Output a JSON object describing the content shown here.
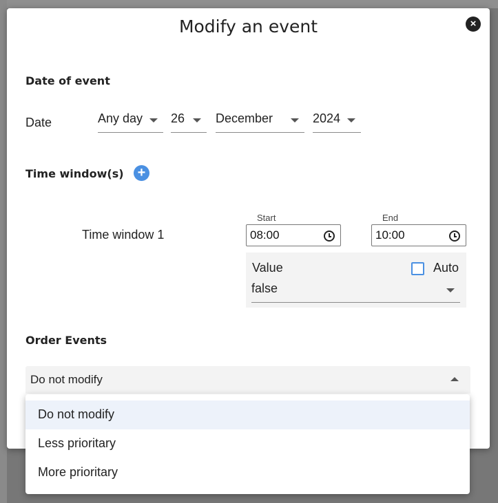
{
  "dialog": {
    "title": "Modify an event",
    "close_symbol": "×"
  },
  "date_section": {
    "title": "Date of event",
    "date_label": "Date",
    "weekday": "Any day",
    "day": "26",
    "month": "December",
    "year": "2024"
  },
  "time_section": {
    "title": "Time window(s)",
    "add_symbol": "+",
    "window_label": "Time window 1",
    "start_label": "Start",
    "start_value": "08:00",
    "end_label": "End",
    "end_value": "10:00",
    "value_label": "Value",
    "auto_label": "Auto",
    "auto_checked": false,
    "value_selected": "false"
  },
  "order_section": {
    "title": "Order Events",
    "selected": "Do not modify",
    "options": [
      "Do not modify",
      "Less prioritary",
      "More prioritary"
    ]
  },
  "icons": {
    "close": "close-icon",
    "add": "plus-icon",
    "clock": "clock-icon",
    "caret": "chevron-down-icon",
    "trash": "trash-icon"
  },
  "colors": {
    "accent": "#4a90e2",
    "selected_option_bg": "#edf2fa",
    "field_bg": "#f3f3f3"
  }
}
